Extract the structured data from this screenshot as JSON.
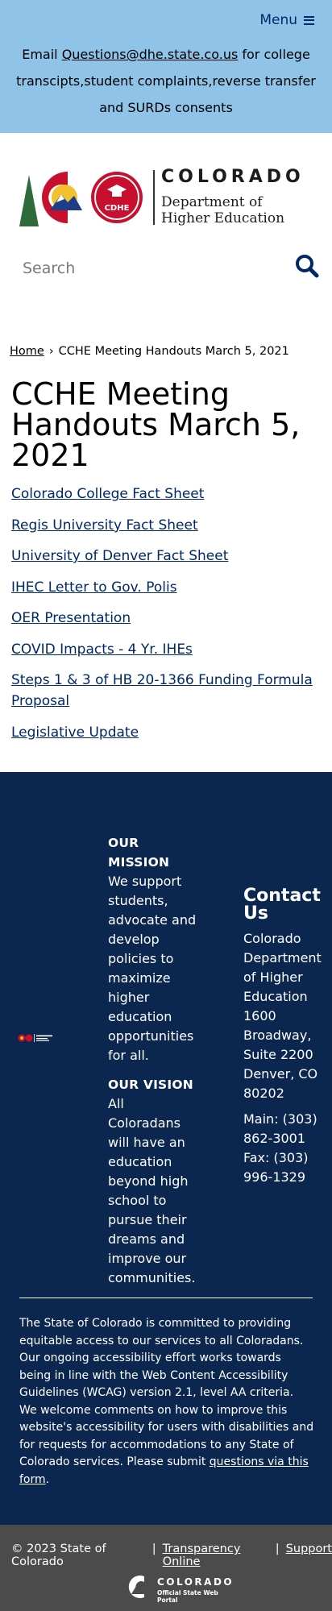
{
  "header": {
    "menu_label": "Menu",
    "banner_prefix": "Email ",
    "banner_email": "Questions@dhe.state.co.us",
    "banner_suffix": " for college transcipts,student complaints,reverse transfer and SURDs consents"
  },
  "logo": {
    "line1": "COLORADO",
    "line2": "Department of",
    "line3": "Higher Education",
    "badge": "CDHE"
  },
  "search": {
    "placeholder": "Search"
  },
  "breadcrumb": {
    "home": "Home",
    "separator": "›",
    "current": "CCHE Meeting Handouts March 5, 2021"
  },
  "page": {
    "title": "CCHE Meeting Handouts March 5, 2021",
    "links": [
      "Colorado College Fact Sheet",
      "Regis University Fact Sheet",
      "University of Denver Fact Sheet",
      "IHEC Letter to Gov. Polis",
      "OER Presentation",
      "COVID Impacts - 4 Yr. IHEs",
      "Steps 1 & 3 of HB 20-1366 Funding Formula Proposal",
      "Legislative Update"
    ]
  },
  "footer": {
    "mission_heading": "OUR MISSION",
    "mission_text": "We support students, advocate and develop policies to maximize higher education opportunities for all.",
    "vision_heading": "OUR VISION",
    "vision_text": "All Coloradans will have an education beyond high school to pursue their dreams and improve our communities.",
    "contact_heading": "Contact Us",
    "contact_address": "Colorado Department of Higher Education 1600 Broadway, Suite 2200 Denver, CO 80202",
    "contact_main": "Main: (303) 862-3001",
    "contact_fax": "Fax: (303) 996-1329",
    "accessibility_text": "The State of Colorado is committed to providing equitable access to our services to all Coloradans. Our ongoing accessibility effort works towards being in line with the Web Content Accessibility Guidelines (WCAG) version 2.1, level AA criteria. We welcome comments on how to improve this website's accessibility for users with disabilities and for requests for accommodations to any State of Colorado services. Please submit ",
    "accessibility_link": "questions via this form",
    "accessibility_end": "."
  },
  "bottom": {
    "copyright": "© 2023 State of Colorado",
    "sep": "|",
    "transparency": "Transparency Online",
    "support": "Support",
    "logo_line1": "COLORADO",
    "logo_line2": "Official State Web Portal"
  },
  "colors": {
    "banner_bg": "#8fc3e8",
    "brand_navy": "#002868",
    "footer_bg": "#0b2750",
    "bottom_bar_bg": "#4b4b4b",
    "logo_red": "#c8102e",
    "logo_gold": "#f2c12e",
    "logo_green": "#2e6b3a"
  }
}
